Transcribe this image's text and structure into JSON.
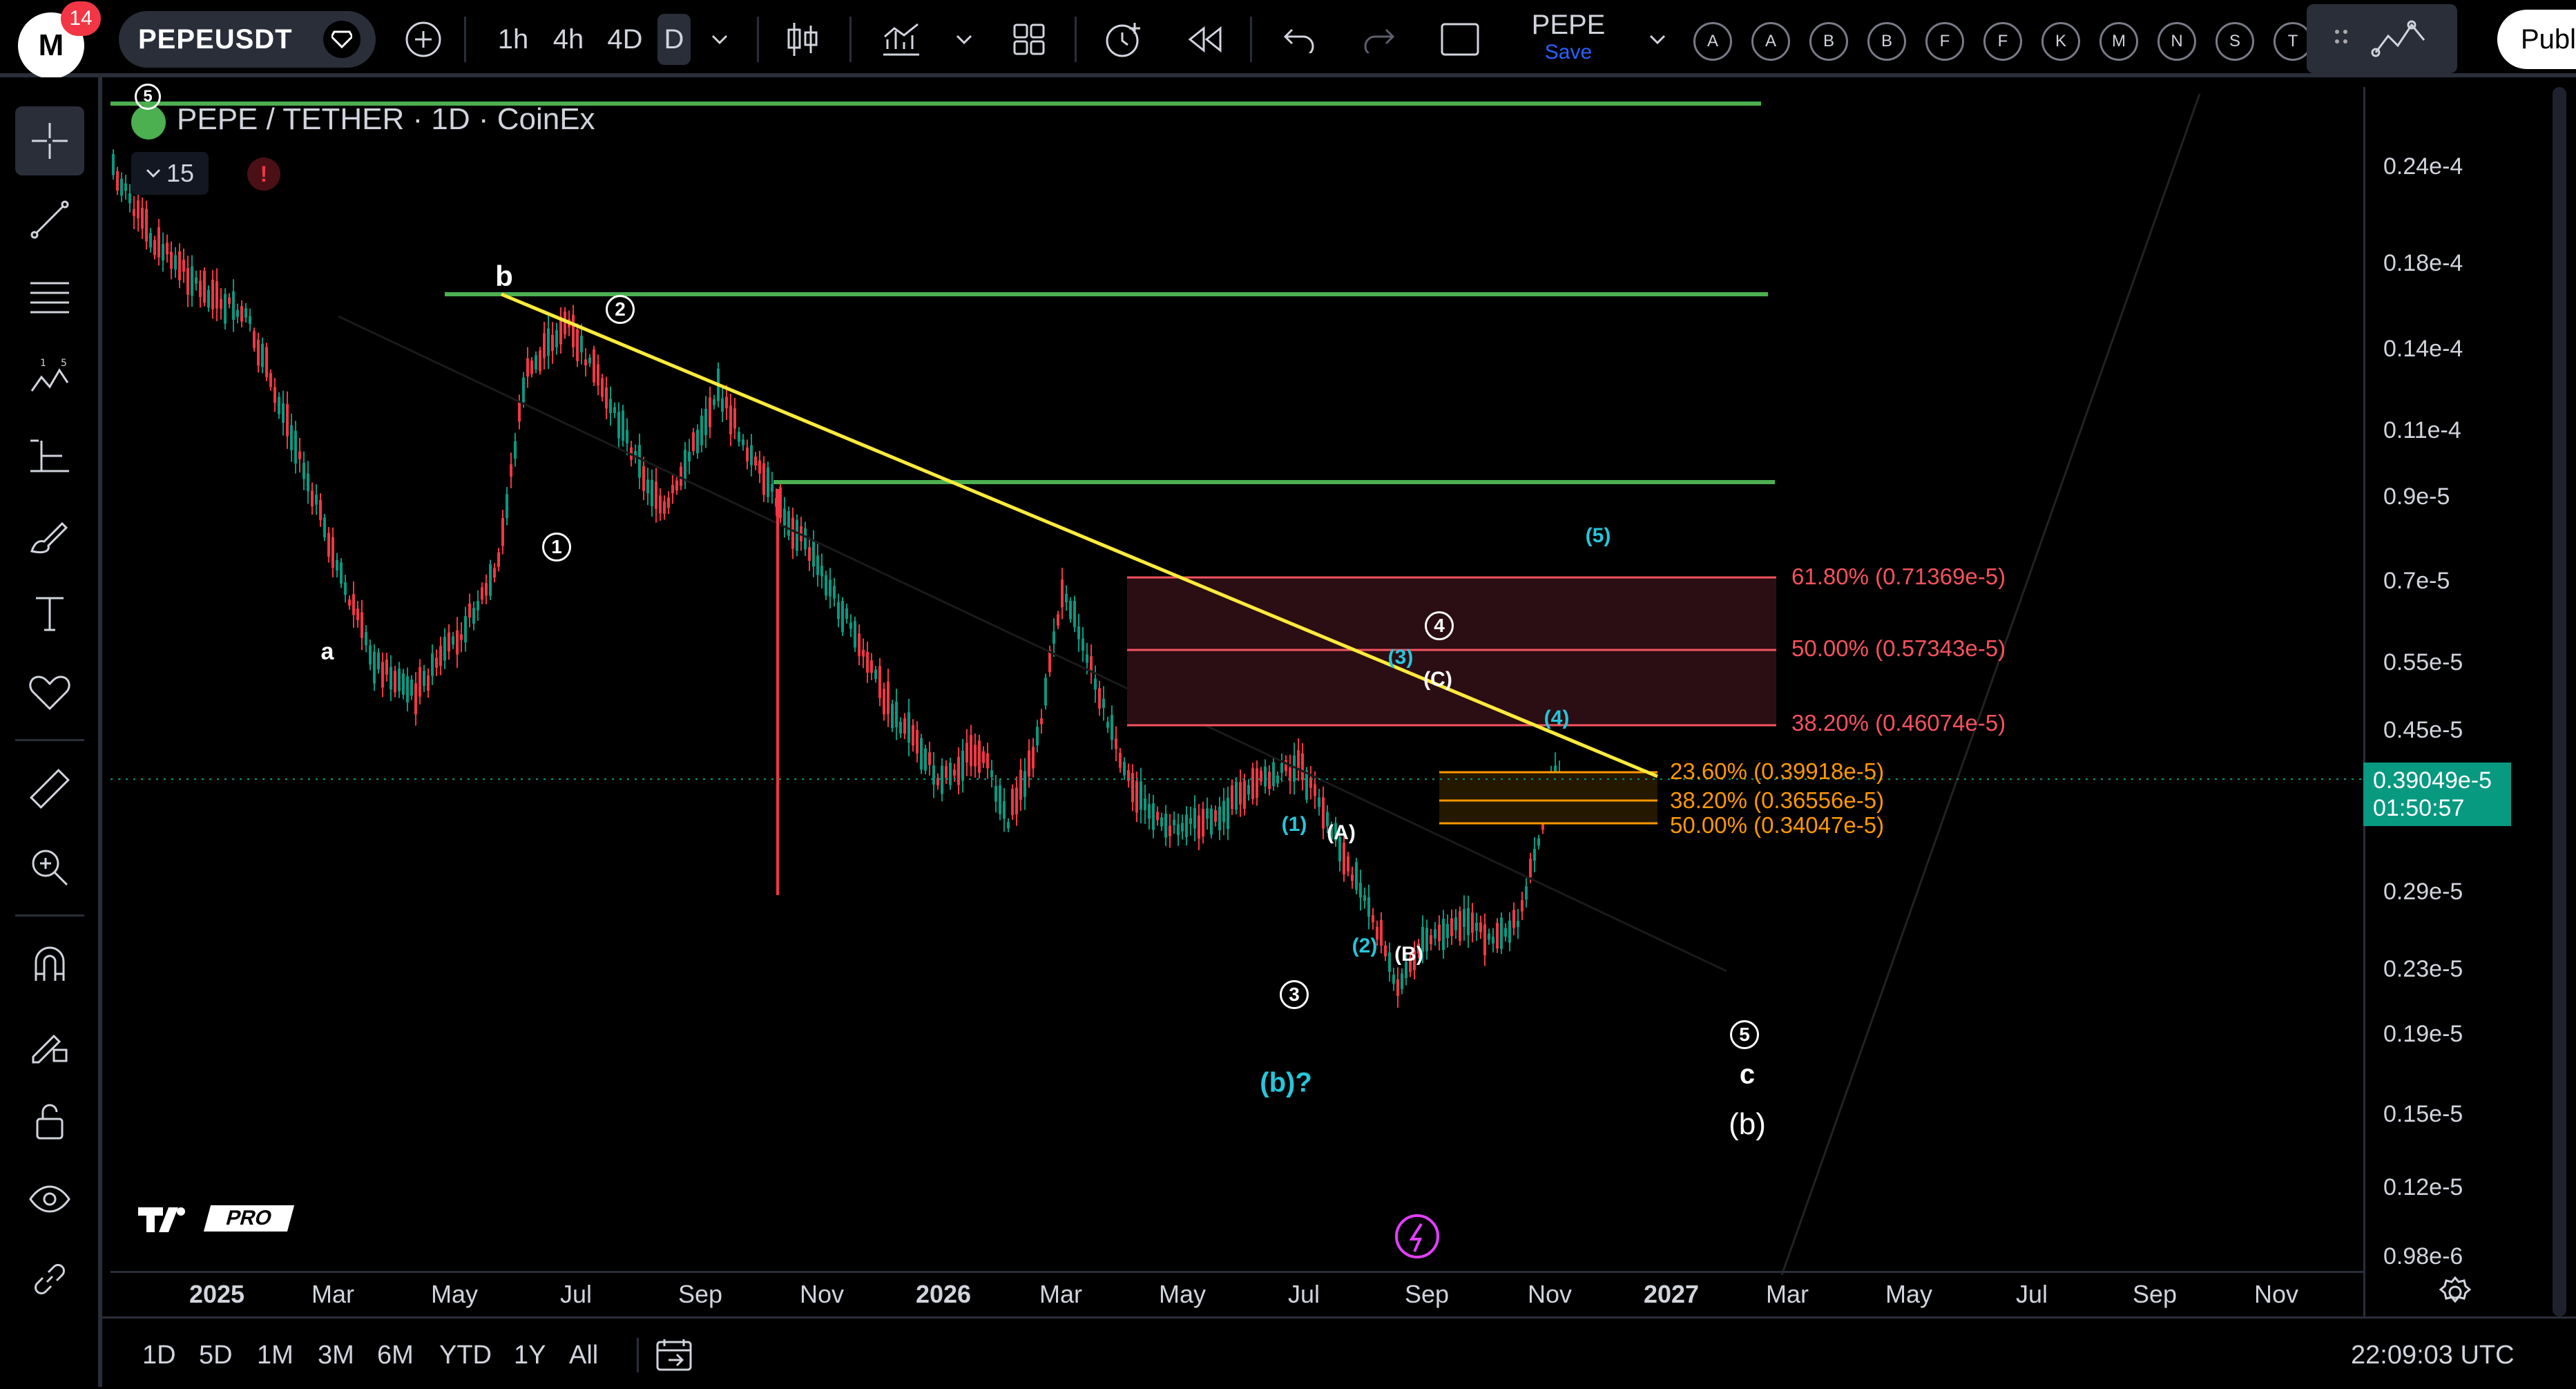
{
  "header": {
    "notification_count": "14",
    "symbol": "PEPEUSDT",
    "intervals": [
      "1h",
      "4h",
      "4D",
      "D"
    ],
    "layout_name": "PEPE",
    "layout_save": "Save",
    "alert_letters": [
      "A",
      "A",
      "B",
      "B",
      "F",
      "F",
      "K",
      "M",
      "N",
      "S",
      "T"
    ],
    "publish_label": "Publ"
  },
  "chart": {
    "legend_title": "PEPE / TETHER · 1D · CoinEx",
    "indicator_count": "15",
    "current_price": "0.39049e-5",
    "countdown": "01:50:57",
    "price_ticks": [
      "0.24e-4",
      "0.18e-4",
      "0.14e-4",
      "0.11e-4",
      "0.9e-5",
      "0.7e-5",
      "0.55e-5",
      "0.45e-5",
      "0.29e-5",
      "0.23e-5",
      "0.19e-5",
      "0.15e-5",
      "0.12e-5",
      "0.98e-6"
    ],
    "time_ticks": [
      "2025",
      "Mar",
      "May",
      "Jul",
      "Sep",
      "Nov",
      "2026",
      "Mar",
      "May",
      "Jul",
      "Sep",
      "Nov",
      "2027",
      "Mar",
      "May",
      "Jul",
      "Sep",
      "Nov"
    ],
    "fib_upper": [
      "61.80% (0.71369e-5)",
      "50.00% (0.57343e-5)",
      "38.20% (0.46074e-5)"
    ],
    "fib_lower": [
      "23.60% (0.39918e-5)",
      "38.20% (0.36556e-5)",
      "50.00% (0.34047e-5)"
    ],
    "wave_labels": {
      "a": "a",
      "b": "b",
      "c": "c",
      "w1": "1",
      "w2": "2",
      "w3": "3",
      "w4": "4",
      "w5": "5",
      "w5top": "5",
      "A": "(A)",
      "B": "(B)",
      "C": "(C)",
      "c1": "(1)",
      "c2": "(2)",
      "c3": "(3)",
      "c4": "(4)",
      "c5": "(5)",
      "bq": "(b)?",
      "bb": "(b)"
    },
    "watermark": "PRO"
  },
  "footer": {
    "ranges": [
      "1D",
      "5D",
      "1M",
      "3M",
      "6M",
      "YTD",
      "1Y",
      "All"
    ],
    "clock": "22:09:03 UTC"
  }
}
